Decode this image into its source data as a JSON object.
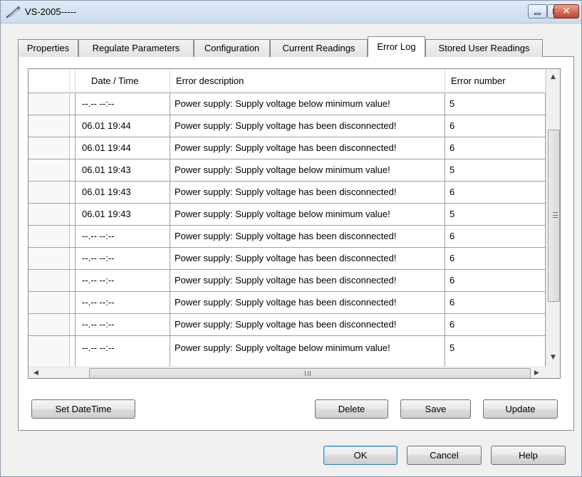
{
  "window": {
    "title": "VS-2005-----",
    "minimize_label": "",
    "maximize_label": "",
    "close_glyph": "✕"
  },
  "tabs": [
    {
      "label": "Properties",
      "active": false
    },
    {
      "label": "Regulate Parameters",
      "active": false
    },
    {
      "label": "Configuration",
      "active": false
    },
    {
      "label": "Current Readings",
      "active": false
    },
    {
      "label": "Error Log",
      "active": true
    },
    {
      "label": "Stored User Readings",
      "active": false
    }
  ],
  "grid": {
    "columns": {
      "date": "Date / Time",
      "desc": "Error description",
      "num": "Error number"
    },
    "rows": [
      {
        "date": "--.-- --:--",
        "desc": "Power supply: Supply voltage below minimum value!",
        "num": "5"
      },
      {
        "date": "06.01 19:44",
        "desc": "Power supply: Supply voltage has been disconnected!",
        "num": "6"
      },
      {
        "date": "06.01 19:44",
        "desc": "Power supply: Supply voltage has been disconnected!",
        "num": "6"
      },
      {
        "date": "06.01 19:43",
        "desc": "Power supply: Supply voltage below minimum value!",
        "num": "5"
      },
      {
        "date": "06.01 19:43",
        "desc": "Power supply: Supply voltage has been disconnected!",
        "num": "6"
      },
      {
        "date": "06.01 19:43",
        "desc": "Power supply: Supply voltage below minimum value!",
        "num": "5"
      },
      {
        "date": "--.-- --:--",
        "desc": "Power supply: Supply voltage has been disconnected!",
        "num": "6"
      },
      {
        "date": "--.-- --:--",
        "desc": "Power supply: Supply voltage has been disconnected!",
        "num": "6"
      },
      {
        "date": "--.-- --:--",
        "desc": "Power supply: Supply voltage has been disconnected!",
        "num": "6"
      },
      {
        "date": "--.-- --:--",
        "desc": "Power supply: Supply voltage has been disconnected!",
        "num": "6"
      },
      {
        "date": "--.-- --:--",
        "desc": "Power supply: Supply voltage has been disconnected!",
        "num": "6"
      },
      {
        "date": "--.-- --:--",
        "desc": "Power supply: Supply voltage below minimum value!",
        "num": "5"
      }
    ]
  },
  "scrollbars": {
    "up_arrow": "▲",
    "down_arrow": "▼",
    "left_arrow": "◀",
    "right_arrow": "▶"
  },
  "actions": {
    "set_datetime": "Set DateTime",
    "delete": "Delete",
    "save": "Save",
    "update": "Update"
  },
  "dialog": {
    "ok": "OK",
    "cancel": "Cancel",
    "help": "Help"
  }
}
